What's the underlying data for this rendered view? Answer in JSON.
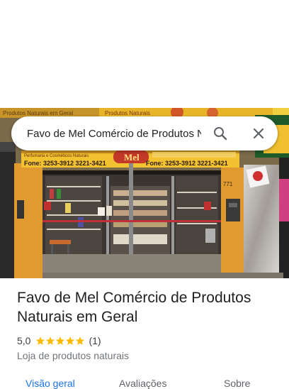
{
  "search": {
    "value": "Favo de Mel Comércio de Produtos Naturais em Geral"
  },
  "photo": {
    "sign_top_text": "Produtos Naturais",
    "sign_left_text": "Perfumaria e Cosméticos Naturais",
    "sign_center_text": "Mel",
    "phone_left": "Fone:  3253-3912  3221-3421",
    "phone_right": "Fone:  3253-3912  3221-3421",
    "sign_top_left_text": "Produtos Naturais em Geral",
    "door_number": "771"
  },
  "place": {
    "title": "Favo de Mel Comércio de Produtos Naturais em Geral",
    "rating": "5,0",
    "stars": 5,
    "reviews": "(1)",
    "category": "Loja de produtos naturais"
  },
  "tabs": [
    {
      "label": "Visão geral",
      "active": true
    },
    {
      "label": "Avaliações",
      "active": false
    },
    {
      "label": "Sobre",
      "active": false
    }
  ],
  "colors": {
    "accent": "#1a73e8",
    "star": "#fbbc04",
    "text": "#202124",
    "secondary": "#70757a"
  }
}
